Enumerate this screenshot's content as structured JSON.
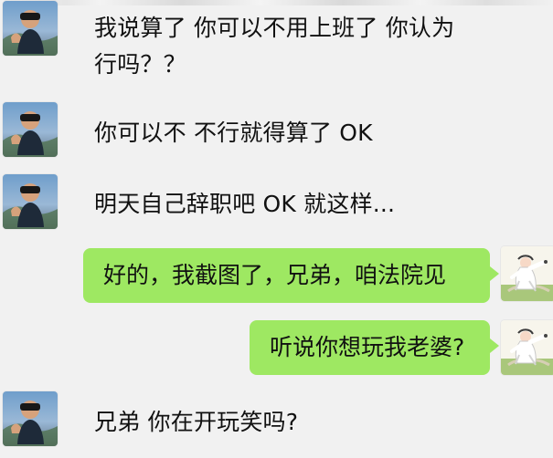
{
  "messages": [
    {
      "side": "left",
      "text_line1": "我说算了 你可以不用上班了 你认为",
      "text_line2": "行吗？？"
    },
    {
      "side": "left",
      "text": "你可以不 不行就得算了 OK"
    },
    {
      "side": "left",
      "text": "明天自己辞职吧 OK 就这样..."
    },
    {
      "side": "right",
      "text": "好的，我截图了，兄弟，咱法院见"
    },
    {
      "side": "right",
      "text": "听说你想玩我老婆?"
    },
    {
      "side": "left",
      "text": "兄弟 你在开玩笑吗?"
    }
  ],
  "colors": {
    "background": "#f1f1f1",
    "bubble_green": "#9ee862",
    "text_dark": "#111111"
  },
  "icons": {
    "left_avatar": "person-photo-avatar",
    "right_avatar": "cartoon-character-avatar"
  }
}
